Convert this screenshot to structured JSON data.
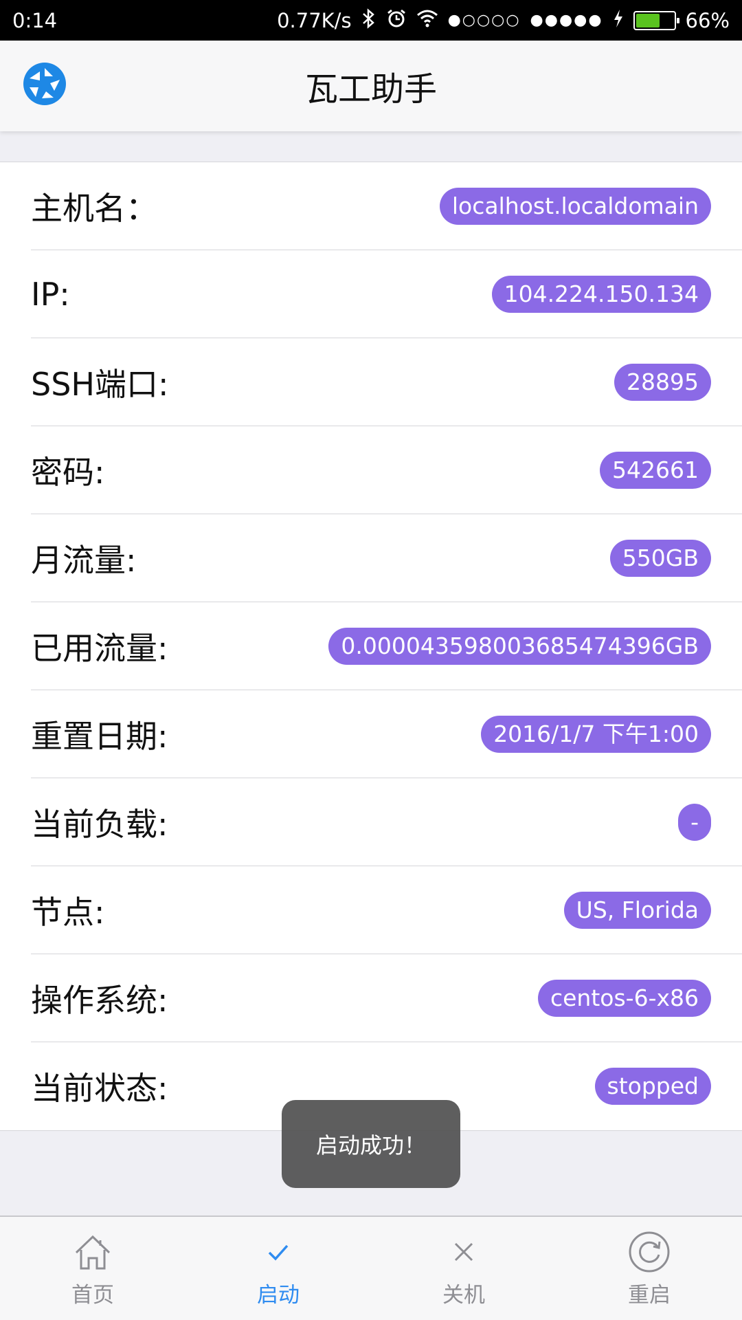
{
  "status_bar": {
    "time": "0:14",
    "network_speed": "0.77K/s",
    "signal1": "●○○○○",
    "signal2": "●●●●●",
    "battery_percent": "66%",
    "battery_level": 0.66,
    "icons": [
      "bluetooth-icon",
      "alarm-icon",
      "wifi-icon",
      "charging-icon"
    ]
  },
  "header": {
    "title": "瓦工助手",
    "logo_icon": "aperture-logo-icon",
    "accent_color": "#1e88e5"
  },
  "rows": [
    {
      "label": "主机名：",
      "value": "localhost.localdomain"
    },
    {
      "label": "IP:",
      "value": "104.224.150.134"
    },
    {
      "label": "SSH端口:",
      "value": "28895"
    },
    {
      "label": "密码:",
      "value": "542661"
    },
    {
      "label": "月流量:",
      "value": "550GB"
    },
    {
      "label": "已用流量:",
      "value": "0.000043598003685474396GB"
    },
    {
      "label": "重置日期:",
      "value": "2016/1/7 下午1:00"
    },
    {
      "label": "当前负载:",
      "value": "-"
    },
    {
      "label": "节点:",
      "value": "US, Florida"
    },
    {
      "label": "操作系统:",
      "value": "centos-6-x86"
    },
    {
      "label": "当前状态:",
      "value": "stopped"
    }
  ],
  "badge_color": "#8b6ae6",
  "toast": {
    "text": "启动成功！"
  },
  "tabs": [
    {
      "label": "首页",
      "icon": "home-icon",
      "active": false
    },
    {
      "label": "启动",
      "icon": "checkmark-icon",
      "active": true
    },
    {
      "label": "关机",
      "icon": "close-icon",
      "active": false
    },
    {
      "label": "重启",
      "icon": "refresh-icon",
      "active": false
    }
  ],
  "tab_active_color": "#2f8cf0"
}
